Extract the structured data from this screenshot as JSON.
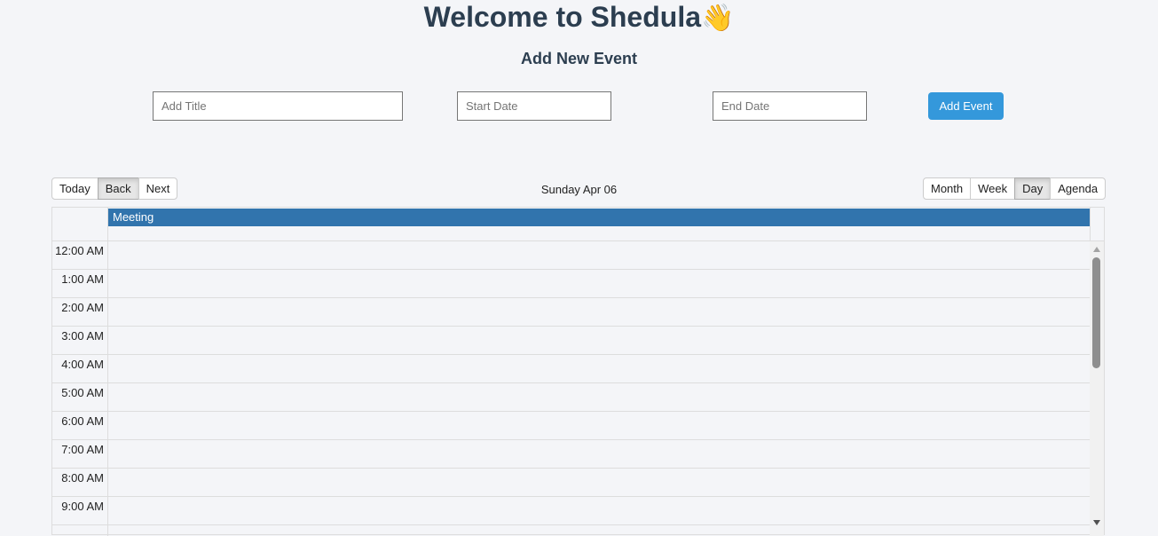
{
  "header": {
    "title": "Welcome to Shedula",
    "title_emoji": "👋",
    "subtitle": "Add New Event"
  },
  "form": {
    "title_placeholder": "Add Title",
    "start_placeholder": "Start Date",
    "end_placeholder": "End Date",
    "submit_label": "Add Event",
    "accent_color": "#3498db"
  },
  "toolbar": {
    "today": "Today",
    "back": "Back",
    "next": "Next",
    "label": "Sunday Apr 06",
    "views": [
      "Month",
      "Week",
      "Day",
      "Agenda"
    ],
    "active_view": "Day"
  },
  "calendar": {
    "allday_events": [
      {
        "title": "Meeting",
        "color": "#3174ad"
      }
    ],
    "time_slots": [
      "12:00 AM",
      "1:00 AM",
      "2:00 AM",
      "3:00 AM",
      "4:00 AM",
      "5:00 AM",
      "6:00 AM",
      "7:00 AM",
      "8:00 AM",
      "9:00 AM"
    ]
  }
}
